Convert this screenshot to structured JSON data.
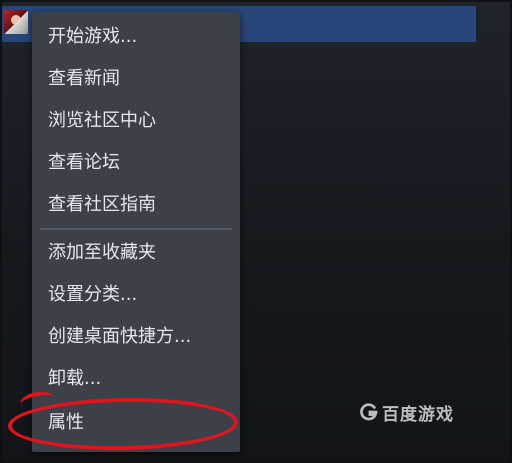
{
  "context_menu": {
    "items": [
      {
        "label": "开始游戏..."
      },
      {
        "label": "查看新闻"
      },
      {
        "label": "浏览社区中心"
      },
      {
        "label": "查看论坛"
      },
      {
        "label": "查看社区指南"
      },
      {
        "label": "添加至收藏夹"
      },
      {
        "label": "设置分类..."
      },
      {
        "label": "创建桌面快捷方..."
      },
      {
        "label": "卸载..."
      },
      {
        "label": "属性"
      }
    ]
  },
  "watermark": {
    "text": "百度游戏",
    "icon": "baidu-games-logo-icon"
  },
  "colors": {
    "menu_background": "#3b4049",
    "selected_row": "#28467a",
    "annotation_circle": "#e0141c",
    "menu_text": "#e6e8eb"
  }
}
